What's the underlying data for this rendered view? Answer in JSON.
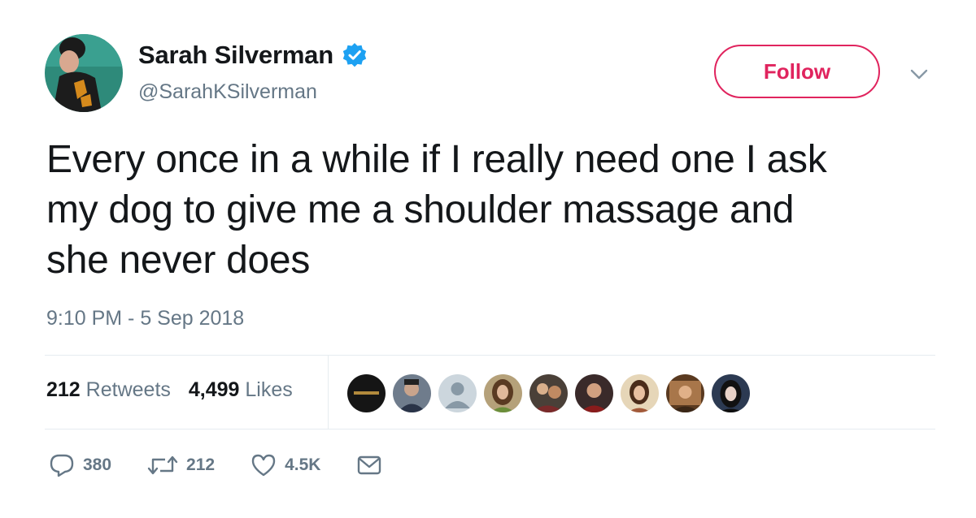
{
  "author": {
    "display_name": "Sarah Silverman",
    "handle": "@SarahKSilverman",
    "verified": true
  },
  "header": {
    "follow_label": "Follow"
  },
  "tweet": {
    "text": "Every once in a while if I really need one I ask\nmy dog to give me a shoulder massage and\nshe never does",
    "timestamp": "9:10 PM - 5 Sep 2018"
  },
  "stats": {
    "retweets_count": "212",
    "retweets_label": "Retweets",
    "likes_count": "4,499",
    "likes_label": "Likes",
    "liker_avatar_count": 9
  },
  "actions": {
    "reply_count": "380",
    "retweet_count": "212",
    "like_count": "4.5K"
  },
  "colors": {
    "accent": "#e0245e",
    "verified": "#1da1f2",
    "secondary_text": "#657786"
  }
}
